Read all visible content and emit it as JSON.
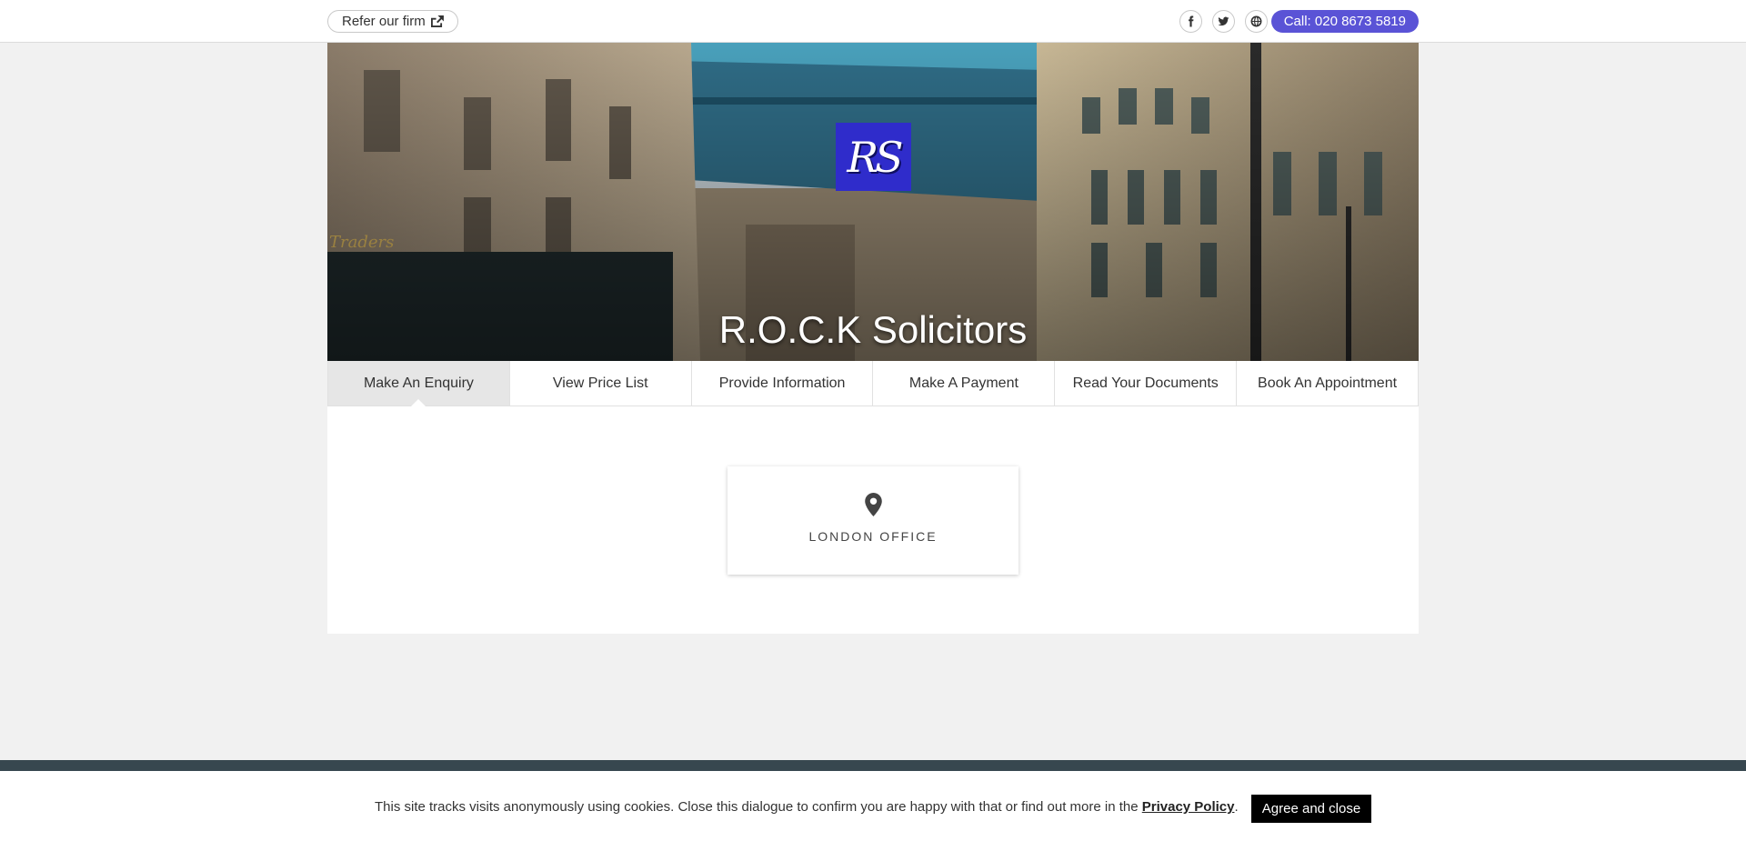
{
  "topbar": {
    "refer_label": "Refer our firm",
    "refer_icon": "share-icon",
    "socials": [
      {
        "name": "facebook-icon"
      },
      {
        "name": "twitter-icon"
      },
      {
        "name": "globe-icon"
      }
    ],
    "call_label": "Call: 020 8673 5819",
    "accent_color": "#5a53d6"
  },
  "hero": {
    "logo_text": "RS",
    "logo_color": "#2f2ccb",
    "title": "R.O.C.K Solicitors"
  },
  "tabs": [
    {
      "label": "Make An Enquiry",
      "active": true
    },
    {
      "label": "View Price List",
      "active": false
    },
    {
      "label": "Provide Information",
      "active": false
    },
    {
      "label": "Make A Payment",
      "active": false
    },
    {
      "label": "Read Your Documents",
      "active": false
    },
    {
      "label": "Book An Appointment",
      "active": false
    }
  ],
  "office": {
    "icon": "map-pin-icon",
    "label": "LONDON OFFICE"
  },
  "cookie": {
    "text": "This site tracks visits anonymously using cookies. Close this dialogue to confirm you are happy with that or find out more in the",
    "link_label": "Privacy Policy",
    "after_link": ".",
    "button_label": "Agree and close"
  },
  "colors": {
    "footer": "#37474f",
    "page_bg": "#f1f1f1"
  }
}
